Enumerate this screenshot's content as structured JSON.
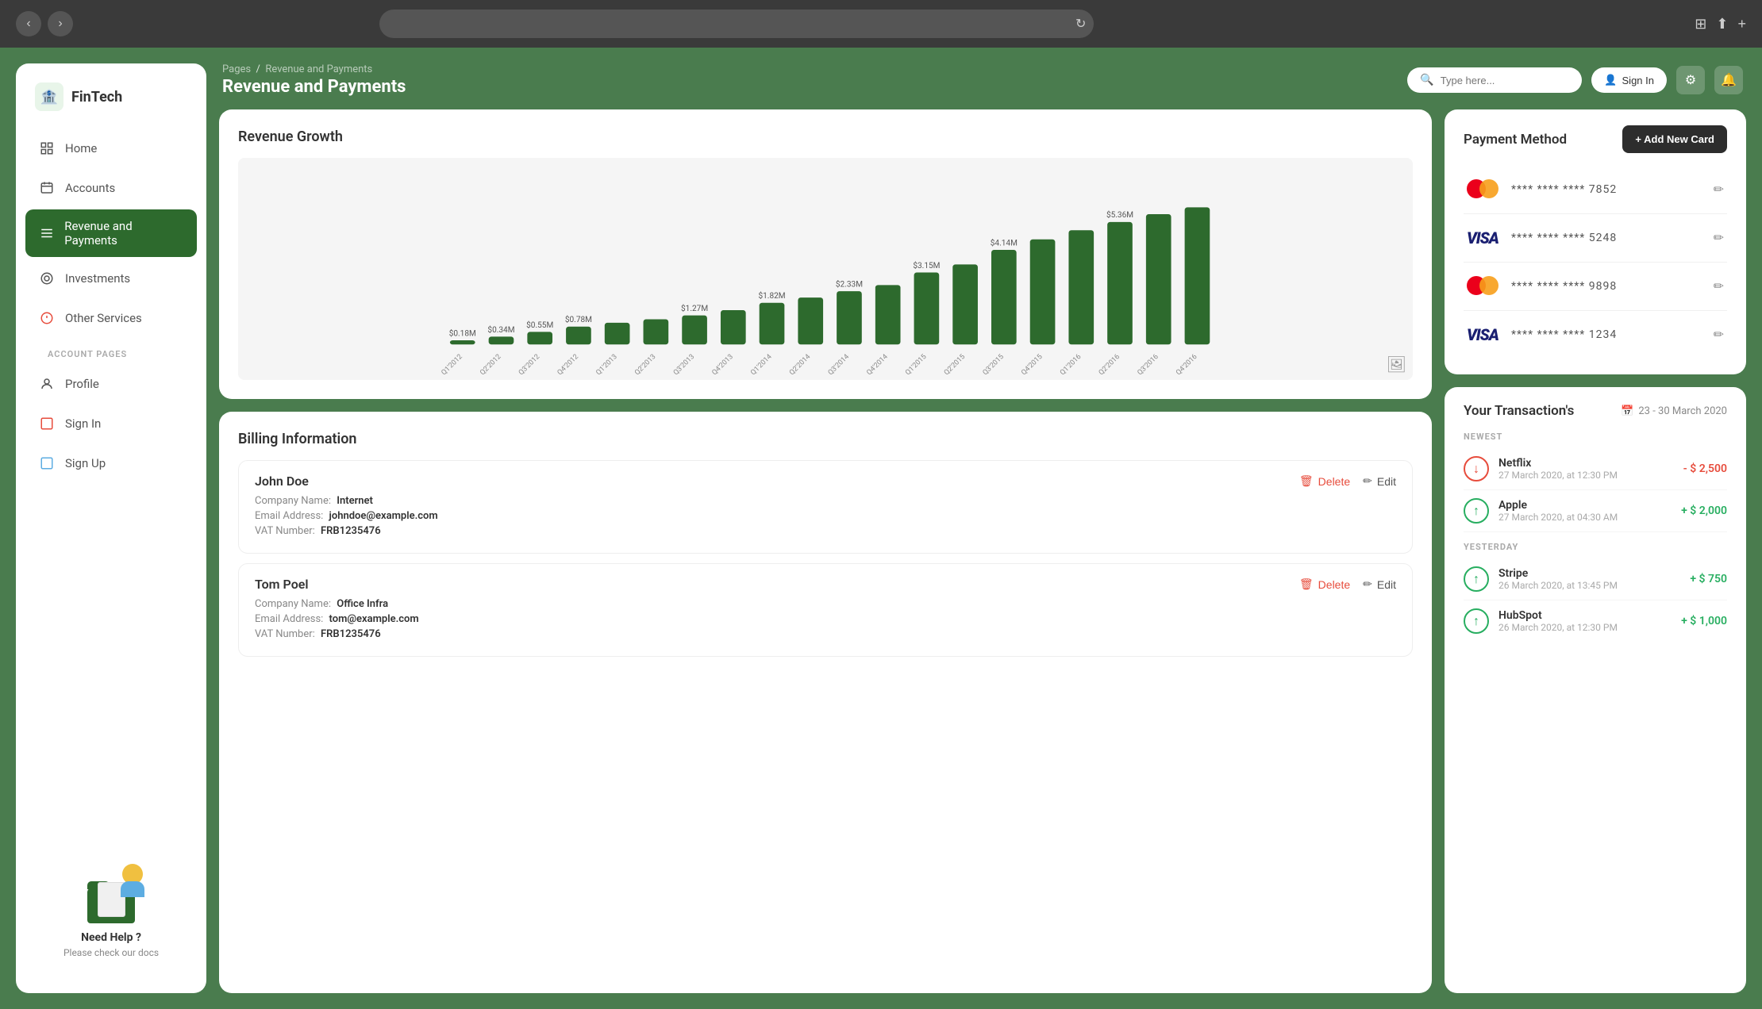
{
  "browser": {
    "refresh_icon": "↻",
    "new_tab_icon": "⊞",
    "share_icon": "⬆",
    "add_icon": "+"
  },
  "sidebar": {
    "logo": {
      "text": "FinTech",
      "icon": "🏦"
    },
    "nav_items": [
      {
        "id": "home",
        "label": "Home",
        "icon": "⊞",
        "active": false
      },
      {
        "id": "accounts",
        "label": "Accounts",
        "icon": "📅",
        "active": false
      },
      {
        "id": "revenue",
        "label": "Revenue and Payments",
        "icon": "≡",
        "active": true
      },
      {
        "id": "investments",
        "label": "Investments",
        "icon": "◎",
        "active": false
      },
      {
        "id": "other",
        "label": "Other Services",
        "icon": "❋",
        "active": false
      }
    ],
    "account_pages_label": "ACCOUNT PAGES",
    "account_items": [
      {
        "id": "profile",
        "label": "Profile",
        "icon": "👤"
      },
      {
        "id": "signin",
        "label": "Sign In",
        "icon": "🔴"
      },
      {
        "id": "signup",
        "label": "Sign Up",
        "icon": "⊞"
      }
    ],
    "help": {
      "title": "Need Help ?",
      "subtitle": "Please check our docs"
    }
  },
  "topbar": {
    "breadcrumb_prefix": "Pages",
    "breadcrumb_separator": "/",
    "breadcrumb_current": "Revenue and Payments",
    "page_title": "Revenue and Payments",
    "search_placeholder": "Type here...",
    "signin_label": "Sign In"
  },
  "chart": {
    "title": "Revenue Growth",
    "bars": [
      {
        "label": "Q1'2012",
        "value": 0.18,
        "display": "$0.18M"
      },
      {
        "label": "Q2'2012",
        "value": 0.34,
        "display": "$0.34M"
      },
      {
        "label": "Q3'2012",
        "value": 0.55,
        "display": "$0.55M"
      },
      {
        "label": "Q4'2012",
        "value": 0.78,
        "display": "$0.78M"
      },
      {
        "label": "Q1'2013",
        "value": 0.95,
        "display": ""
      },
      {
        "label": "Q2'2013",
        "value": 1.1,
        "display": ""
      },
      {
        "label": "Q3'2013",
        "value": 1.27,
        "display": "$1.27M"
      },
      {
        "label": "Q4'2013",
        "value": 1.5,
        "display": ""
      },
      {
        "label": "Q1'2014",
        "value": 1.82,
        "display": "$1.82M"
      },
      {
        "label": "Q2'2014",
        "value": 2.05,
        "display": ""
      },
      {
        "label": "Q3'2014",
        "value": 2.33,
        "display": "$2.33M"
      },
      {
        "label": "Q4'2014",
        "value": 2.6,
        "display": ""
      },
      {
        "label": "Q1'2015",
        "value": 3.15,
        "display": "$3.15M"
      },
      {
        "label": "Q2'2015",
        "value": 3.5,
        "display": ""
      },
      {
        "label": "Q3'2015",
        "value": 4.14,
        "display": "$4.14M"
      },
      {
        "label": "Q4'2015",
        "value": 4.6,
        "display": ""
      },
      {
        "label": "Q1'2016",
        "value": 5.0,
        "display": ""
      },
      {
        "label": "Q2'2016",
        "value": 5.36,
        "display": "$5.36M"
      },
      {
        "label": "Q3'2016",
        "value": 5.7,
        "display": ""
      },
      {
        "label": "Q4'2016",
        "value": 6.0,
        "display": ""
      }
    ],
    "max_value": 7.0
  },
  "payment_methods": {
    "title": "Payment Method",
    "add_btn_label": "+ Add New Card",
    "cards": [
      {
        "type": "mastercard",
        "number": "**** **** **** 7852"
      },
      {
        "type": "visa",
        "number": "**** **** **** 5248"
      },
      {
        "type": "mastercard",
        "number": "**** **** **** 9898"
      },
      {
        "type": "visa",
        "number": "**** **** **** 1234"
      }
    ]
  },
  "billing": {
    "title": "Billing Information",
    "items": [
      {
        "name": "John Doe",
        "company_label": "Company Name:",
        "company_value": "Internet",
        "email_label": "Email Address:",
        "email_value": "johndoe@example.com",
        "vat_label": "VAT Number:",
        "vat_value": "FRB1235476",
        "delete_label": "Delete",
        "edit_label": "Edit"
      },
      {
        "name": "Tom Poel",
        "company_label": "Company Name:",
        "company_value": "Office Infra",
        "email_label": "Email Address:",
        "email_value": "tom@example.com",
        "vat_label": "VAT Number:",
        "vat_value": "FRB1235476",
        "delete_label": "Delete",
        "edit_label": "Edit"
      }
    ]
  },
  "transactions": {
    "title": "Your Transaction's",
    "date_range": "23 - 30 March 2020",
    "newest_label": "NEWEST",
    "yesterday_label": "YESTERDAY",
    "items_newest": [
      {
        "name": "Netflix",
        "date": "27 March 2020, at 12:30 PM",
        "amount": "- $ 2,500",
        "type": "outgoing"
      },
      {
        "name": "Apple",
        "date": "27 March 2020, at 04:30 AM",
        "amount": "+ $ 2,000",
        "type": "incoming"
      }
    ],
    "items_yesterday": [
      {
        "name": "Stripe",
        "date": "26 March 2020, at 13:45 PM",
        "amount": "+ $ 750",
        "type": "incoming"
      },
      {
        "name": "HubSpot",
        "date": "26 March 2020, at 12:30 PM",
        "amount": "+ $ 1,000",
        "type": "incoming"
      }
    ]
  }
}
